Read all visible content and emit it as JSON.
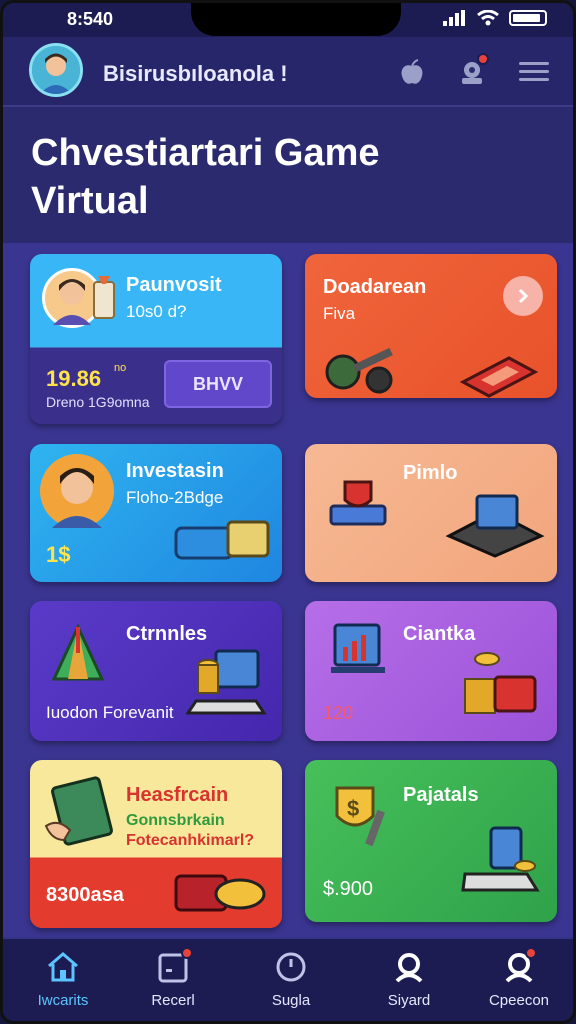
{
  "status_bar": {
    "time": "8:540"
  },
  "header": {
    "app_title": "Bisirusbıloanola !"
  },
  "page": {
    "title_line1": "Chvestiartari Game",
    "title_line2": "Virtual"
  },
  "cards": [
    {
      "title": "Paunvosit",
      "subtitle": "10s0 d?",
      "value": "19.86",
      "value_sup": "no",
      "footer": "Dreno 1G9omna",
      "button": "BHVV"
    },
    {
      "title": "Doadarean",
      "subtitle": "Fiva"
    },
    {
      "title": "Investasin",
      "subtitle": "Floho-2Bdge",
      "value": "1$"
    },
    {
      "title": "Pimlo"
    },
    {
      "title": "Ctrnnles",
      "footer": "Iuodon Forevanit"
    },
    {
      "title": "Ciantka",
      "value": "120"
    },
    {
      "title": "Heasfrcain",
      "subtitle": "Gonnsbrkain",
      "subtitle2": "Fotecanhkimarl?",
      "footer": "8300asa"
    },
    {
      "title": "Pajatals",
      "value": "$.900"
    }
  ],
  "nav": [
    {
      "label": "Iwcarits",
      "icon": "home-icon",
      "active": true
    },
    {
      "label": "Recerl",
      "icon": "inbox-icon"
    },
    {
      "label": "Sugla",
      "icon": "clock-icon"
    },
    {
      "label": "Siyard",
      "icon": "user-icon"
    },
    {
      "label": "Cpeecon",
      "icon": "user-alert-icon"
    }
  ],
  "colors": {
    "accent": "#5cc5ff",
    "background": "#2b2a6e",
    "badge": "#e8433a"
  }
}
